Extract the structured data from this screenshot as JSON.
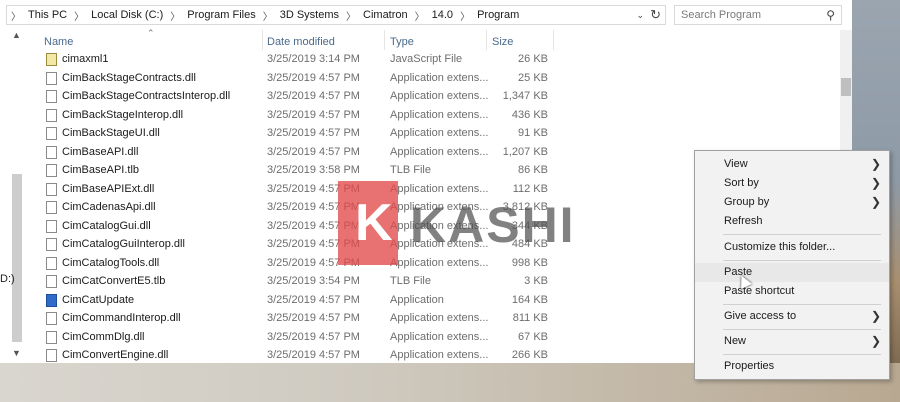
{
  "address_bar": {
    "crumbs": [
      "This PC",
      "Local Disk (C:)",
      "Program Files",
      "3D Systems",
      "Cimatron",
      "14.0",
      "Program"
    ],
    "separator": ">"
  },
  "search": {
    "placeholder": "Search Program"
  },
  "columns": {
    "name": "Name",
    "date": "Date modified",
    "type": "Type",
    "size": "Size"
  },
  "files": [
    {
      "name": "cimaxml1",
      "date": "3/25/2019 3:14 PM",
      "type": "JavaScript File",
      "size": "26 KB",
      "icon": "xml-file-icon"
    },
    {
      "name": "CimBackStageContracts.dll",
      "date": "3/25/2019 4:57 PM",
      "type": "Application extens...",
      "size": "25 KB",
      "icon": "dll-file-icon"
    },
    {
      "name": "CimBackStageContractsInterop.dll",
      "date": "3/25/2019 4:57 PM",
      "type": "Application extens...",
      "size": "1,347 KB",
      "icon": "dll-file-icon"
    },
    {
      "name": "CimBackStageInterop.dll",
      "date": "3/25/2019 4:57 PM",
      "type": "Application extens...",
      "size": "436 KB",
      "icon": "dll-file-icon"
    },
    {
      "name": "CimBackStageUI.dll",
      "date": "3/25/2019 4:57 PM",
      "type": "Application extens...",
      "size": "91 KB",
      "icon": "dll-file-icon"
    },
    {
      "name": "CimBaseAPI.dll",
      "date": "3/25/2019 4:57 PM",
      "type": "Application extens...",
      "size": "1,207 KB",
      "icon": "dll-file-icon"
    },
    {
      "name": "CimBaseAPI.tlb",
      "date": "3/25/2019 3:58 PM",
      "type": "TLB File",
      "size": "86 KB",
      "icon": "tlb-file-icon"
    },
    {
      "name": "CimBaseAPIExt.dll",
      "date": "3/25/2019 4:57 PM",
      "type": "Application extens...",
      "size": "112 KB",
      "icon": "dll-file-icon"
    },
    {
      "name": "CimCadenasApi.dll",
      "date": "3/25/2019 4:57 PM",
      "type": "Application extens...",
      "size": "3,812 KB",
      "icon": "dll-file-icon"
    },
    {
      "name": "CimCatalogGui.dll",
      "date": "3/25/2019 4:57 PM",
      "type": "Application extens...",
      "size": "344 KB",
      "icon": "dll-file-icon"
    },
    {
      "name": "CimCatalogGuiInterop.dll",
      "date": "3/25/2019 4:57 PM",
      "type": "Application extens...",
      "size": "484 KB",
      "icon": "dll-file-icon"
    },
    {
      "name": "CimCatalogTools.dll",
      "date": "3/25/2019 4:57 PM",
      "type": "Application extens...",
      "size": "998 KB",
      "icon": "dll-file-icon"
    },
    {
      "name": "CimCatConvertE5.tlb",
      "date": "3/25/2019 3:54 PM",
      "type": "TLB File",
      "size": "3 KB",
      "icon": "tlb-file-icon"
    },
    {
      "name": "CimCatUpdate",
      "date": "3/25/2019 4:57 PM",
      "type": "Application",
      "size": "164 KB",
      "icon": "app-icon"
    },
    {
      "name": "CimCommandInterop.dll",
      "date": "3/25/2019 4:57 PM",
      "type": "Application extens...",
      "size": "811 KB",
      "icon": "dll-file-icon"
    },
    {
      "name": "CimCommDlg.dll",
      "date": "3/25/2019 4:57 PM",
      "type": "Application extens...",
      "size": "67 KB",
      "icon": "dll-file-icon"
    },
    {
      "name": "CimConvertEngine.dll",
      "date": "3/25/2019 4:57 PM",
      "type": "Application extens...",
      "size": "266 KB",
      "icon": "dll-file-icon"
    }
  ],
  "context_menu": {
    "items": [
      {
        "label": "View",
        "submenu": true
      },
      {
        "label": "Sort by",
        "submenu": true
      },
      {
        "label": "Group by",
        "submenu": true
      },
      {
        "label": "Refresh",
        "submenu": false
      },
      {
        "label": "Customize this folder...",
        "submenu": false
      },
      {
        "label": "Paste",
        "submenu": false,
        "highlighted": true
      },
      {
        "label": "Paste shortcut",
        "submenu": false
      },
      {
        "label": "Give access to",
        "submenu": true
      },
      {
        "label": "New",
        "submenu": true
      },
      {
        "label": "Properties",
        "submenu": false
      }
    ]
  },
  "watermark": {
    "letter": "K",
    "text": "KASHI"
  },
  "left_edge_text": "D:)",
  "colors": {
    "header_text": "#4a6a8a",
    "menu_bg": "#f2f2f2",
    "watermark_red": "#e24a4a"
  }
}
